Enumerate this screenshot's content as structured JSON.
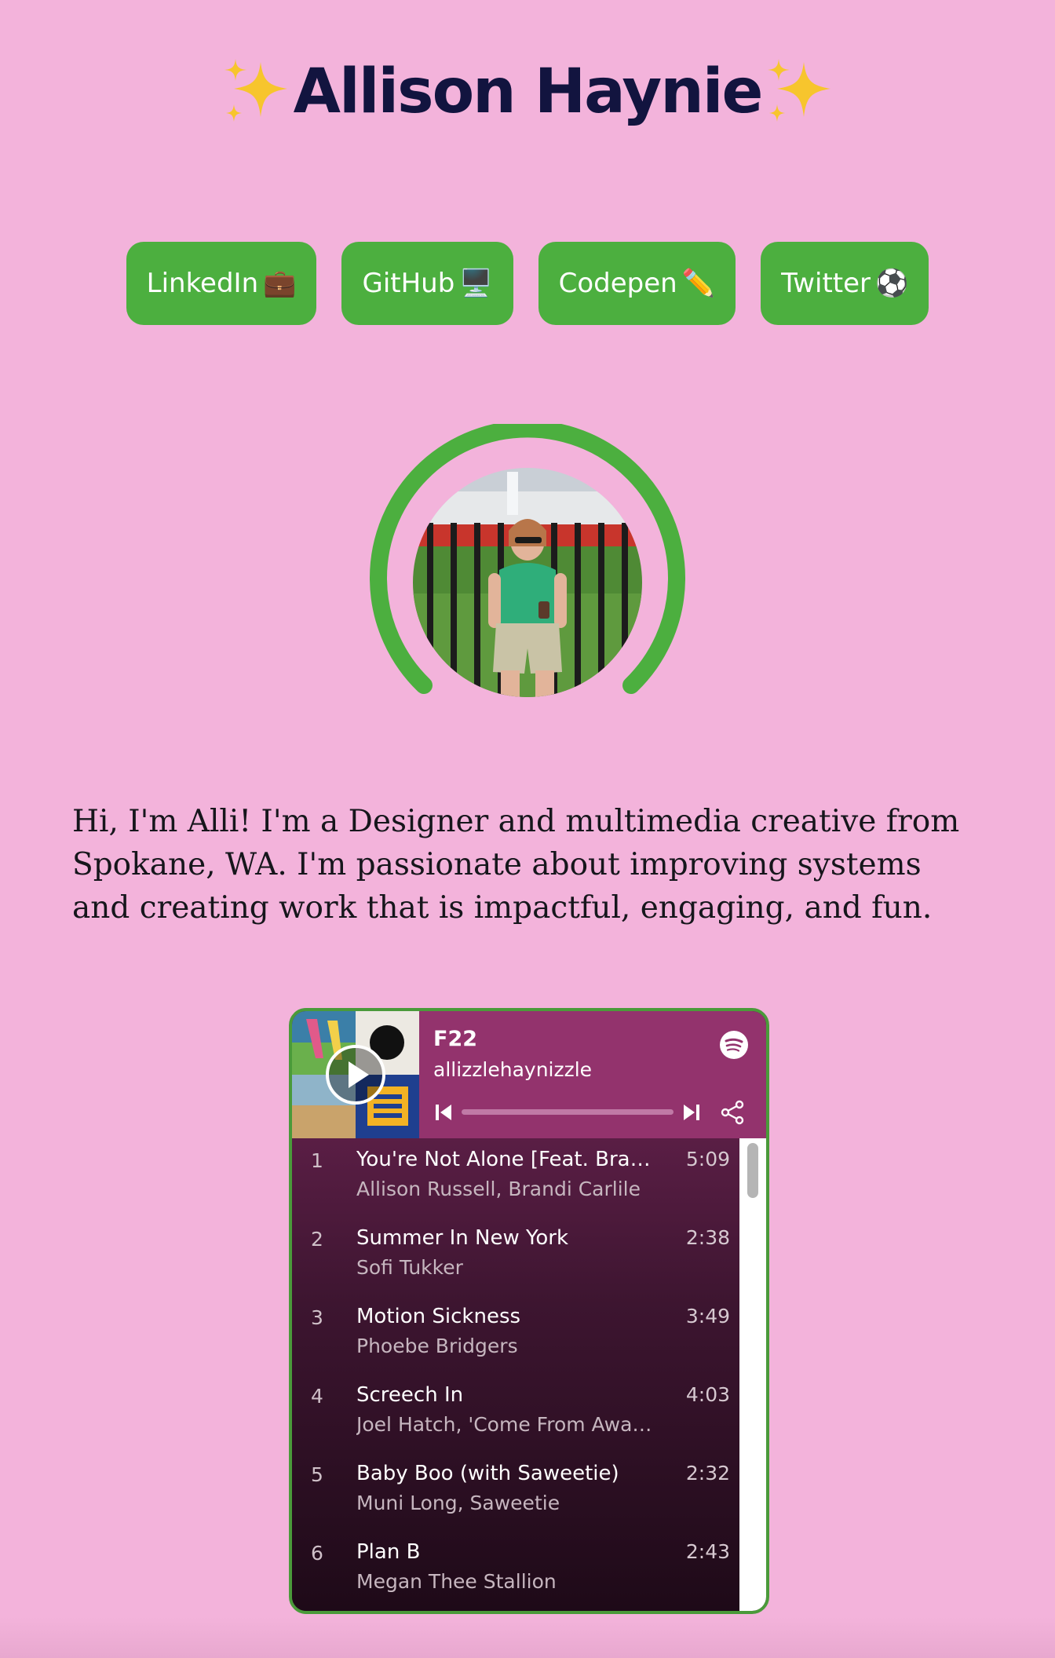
{
  "header": {
    "title": "Allison Haynie",
    "left_icon": "sparkles-icon",
    "right_icon": "sparkles-icon"
  },
  "links": [
    {
      "label": "LinkedIn",
      "emoji": "💼"
    },
    {
      "label": "GitHub",
      "emoji": "🖥️"
    },
    {
      "label": "Codepen",
      "emoji": "✏️"
    },
    {
      "label": "Twitter",
      "emoji": "⚽"
    }
  ],
  "profile": {
    "ring_color": "#4caf3f"
  },
  "bio": {
    "text": "Hi, I'm Alli! I'm a Designer and multimedia creative from Spokane, WA. I'm passionate about improving systems and creating work that is impactful, engaging, and fun."
  },
  "spotify": {
    "playlist_name": "F22",
    "owner": "allizzlehaynizzle",
    "header_color": "#93336d",
    "tracks": [
      {
        "num": "1",
        "title": "You're Not Alone [Feat. Brandi Carlile]",
        "artist": "Allison Russell, Brandi Carlile",
        "duration": "5:09"
      },
      {
        "num": "2",
        "title": "Summer In New York",
        "artist": "Sofi Tukker",
        "duration": "2:38"
      },
      {
        "num": "3",
        "title": "Motion Sickness",
        "artist": "Phoebe Bridgers",
        "duration": "3:49"
      },
      {
        "num": "4",
        "title": "Screech In",
        "artist": "Joel Hatch, 'Come From Away' Ensemble",
        "duration": "4:03"
      },
      {
        "num": "5",
        "title": "Baby Boo (with Saweetie)",
        "artist": "Muni Long, Saweetie",
        "duration": "2:32"
      },
      {
        "num": "6",
        "title": "Plan B",
        "artist": "Megan Thee Stallion",
        "duration": "2:43"
      }
    ]
  },
  "colors": {
    "background": "#f3b3db",
    "title": "#12143f",
    "button": "#4caf3f"
  }
}
